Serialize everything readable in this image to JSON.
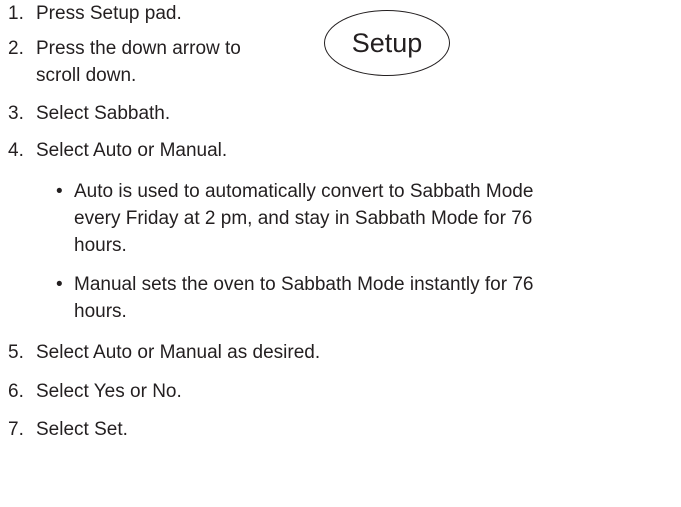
{
  "steps": [
    {
      "number": "1.",
      "lines": [
        "Press Setup pad."
      ]
    },
    {
      "number": "2.",
      "lines": [
        "Press the down arrow to",
        "scroll down."
      ]
    },
    {
      "number": "3.",
      "lines": [
        "Select Sabbath."
      ]
    },
    {
      "number": "4.",
      "lines": [
        "Select Auto or Manual."
      ]
    },
    {
      "number": "5.",
      "lines": [
        "Select Auto or Manual as desired."
      ]
    },
    {
      "number": "6.",
      "lines": [
        "Select Yes or No."
      ]
    },
    {
      "number": "7.",
      "lines": [
        "Select Set."
      ]
    }
  ],
  "step4_bullets": [
    {
      "lines": [
        "Auto is used to automatically convert to Sabbath Mode",
        "every Friday at 2 pm, and stay in Sabbath Mode for 76",
        "hours."
      ]
    },
    {
      "lines": [
        "Manual sets the oven to Sabbath Mode instantly for 76",
        "hours."
      ]
    }
  ],
  "bullet_glyph": "•",
  "setup_pad": {
    "label": "Setup"
  }
}
